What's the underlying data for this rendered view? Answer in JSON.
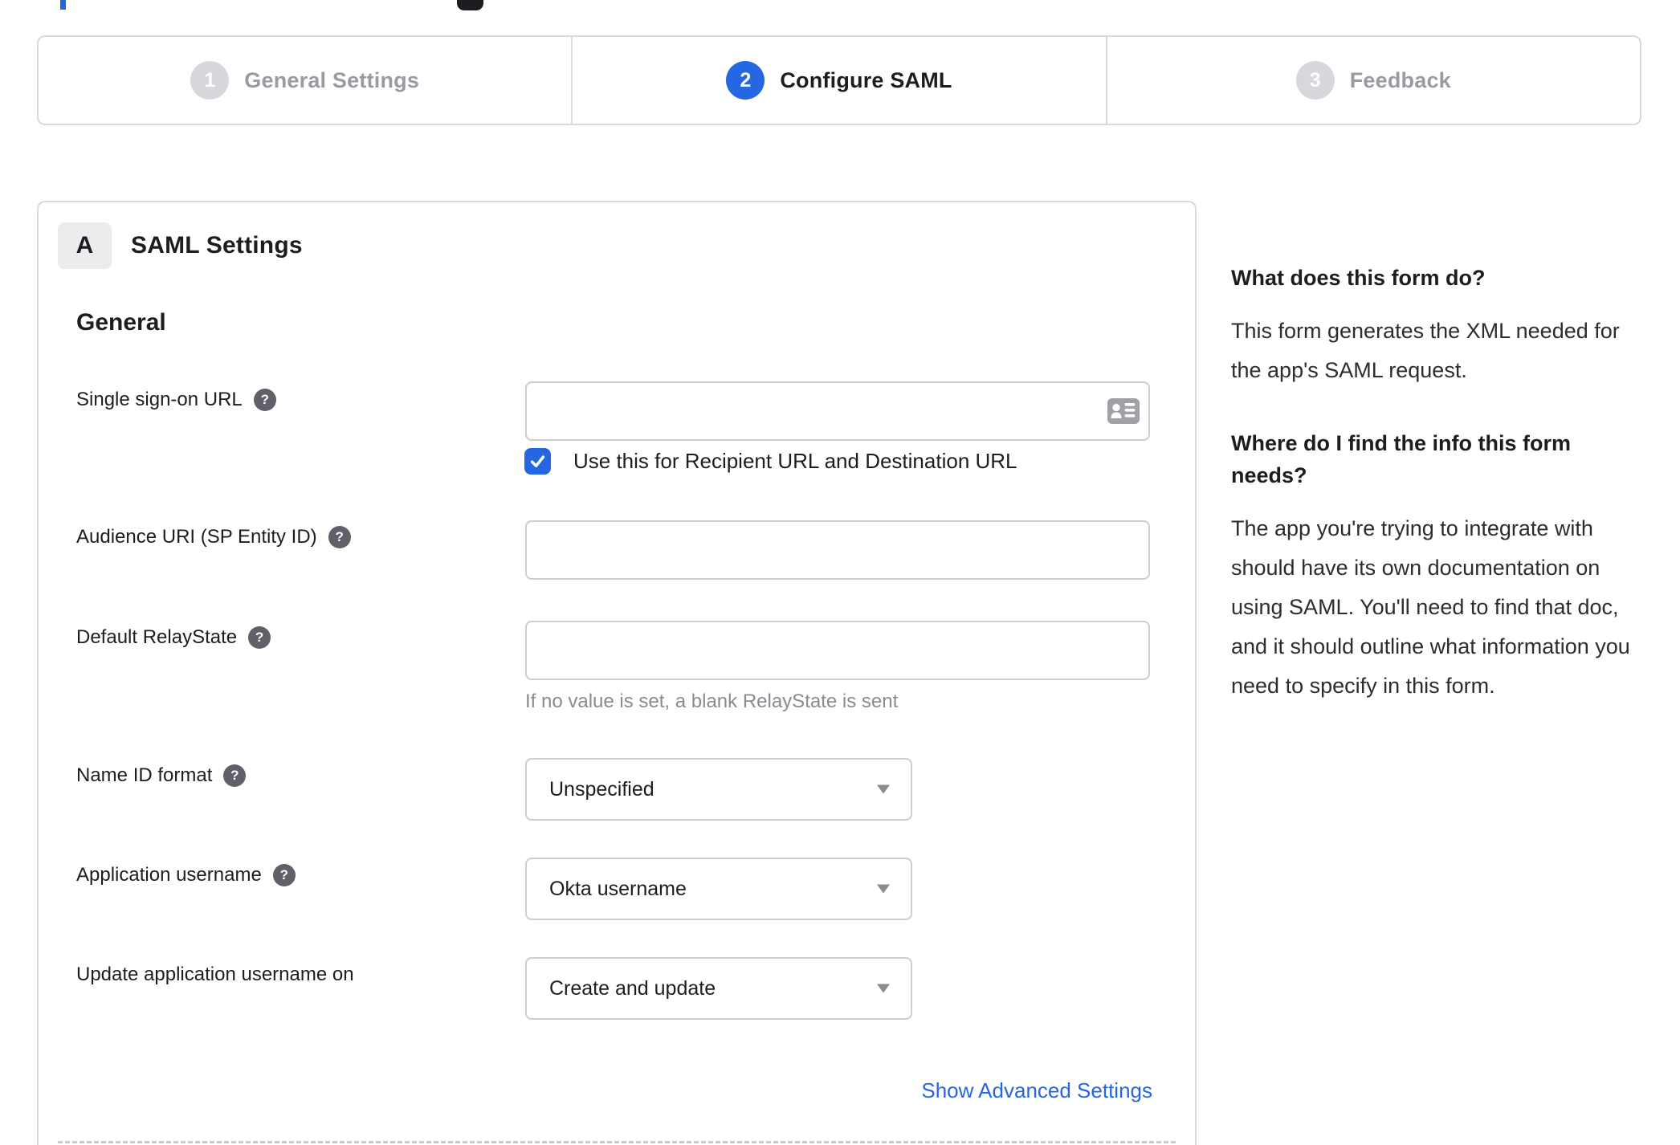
{
  "colors": {
    "accent_blue": "#2566e3",
    "link_blue": "#2566e3",
    "text_dark": "#1d1d21",
    "muted_gray": "#9a9aa2",
    "border_gray": "#d9d9de",
    "input_border": "#cdcdd2",
    "help_icon_bg": "#606069",
    "inactive_step_bg": "#d8d8dc"
  },
  "stepper": {
    "steps": [
      {
        "number": "1",
        "label": "General Settings",
        "state": "inactive"
      },
      {
        "number": "2",
        "label": "Configure SAML",
        "state": "active"
      },
      {
        "number": "3",
        "label": "Feedback",
        "state": "inactive"
      }
    ]
  },
  "panel": {
    "badge": "A",
    "title": "SAML Settings",
    "section_heading": "General",
    "fields": {
      "sso": {
        "label": "Single sign-on URL",
        "value": "",
        "checkbox_label": "Use this for Recipient URL and Destination URL",
        "checkbox_checked": true
      },
      "audience": {
        "label": "Audience URI (SP Entity ID)",
        "value": ""
      },
      "relay": {
        "label": "Default RelayState",
        "value": "",
        "hint": "If no value is set, a blank RelayState is sent"
      },
      "name_id": {
        "label": "Name ID format",
        "value": "Unspecified"
      },
      "app_username": {
        "label": "Application username",
        "value": "Okta username"
      },
      "update_username": {
        "label": "Update application username on",
        "value": "Create and update"
      }
    },
    "advanced_link": "Show Advanced Settings"
  },
  "sidebar": {
    "sections": [
      {
        "heading": "What does this form do?",
        "body": "This form generates the XML needed for the app's SAML request."
      },
      {
        "heading": "Where do I find the info this form needs?",
        "body": "The app you're trying to integrate with should have its own documentation on using SAML. You'll need to find that doc, and it should outline what information you need to specify in this form."
      }
    ]
  }
}
